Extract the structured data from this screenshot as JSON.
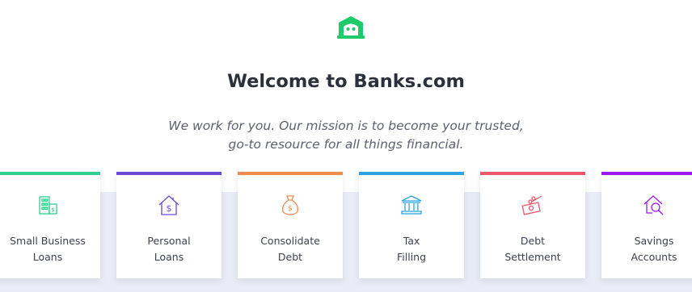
{
  "header": {
    "logo_icon": "bank-logo-icon",
    "title": "Welcome to Banks.com",
    "subtitle_line1": "We work for you. Our mission is to become your trusted,",
    "subtitle_line2": "go-to resource for all things financial."
  },
  "colors": {
    "brand": "#1ecb6b",
    "band": "#e9ecf6"
  },
  "cards": [
    {
      "line1": "Small Business",
      "line2": "Loans",
      "icon": "business-building-icon",
      "color": "#2ed08b"
    },
    {
      "line1": "Personal",
      "line2": "Loans",
      "icon": "house-dollar-icon",
      "color": "#6a4bd6"
    },
    {
      "line1": "Consolidate",
      "line2": "Debt",
      "icon": "money-bag-icon",
      "color": "#f5894e"
    },
    {
      "line1": "Tax",
      "line2": "Filling",
      "icon": "bank-building-icon",
      "color": "#2aa3e0"
    },
    {
      "line1": "Debt",
      "line2": "Settlement",
      "icon": "cash-cut-icon",
      "color": "#f0566a"
    },
    {
      "line1": "Savings",
      "line2": "Accounts",
      "icon": "house-search-icon",
      "color": "#9b17f0"
    }
  ]
}
